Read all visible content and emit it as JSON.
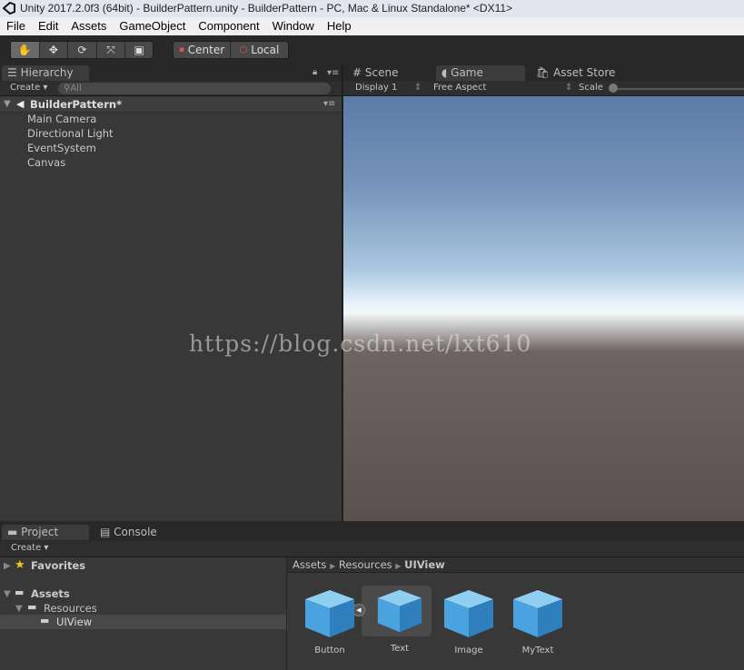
{
  "window": {
    "title": "Unity 2017.2.0f3 (64bit) - BuilderPattern.unity - BuilderPattern - PC, Mac & Linux Standalone* <DX11>"
  },
  "menu": [
    "File",
    "Edit",
    "Assets",
    "GameObject",
    "Component",
    "Window",
    "Help"
  ],
  "toolbar": {
    "tools": [
      "hand-tool",
      "move-tool",
      "rotate-tool",
      "scale-tool",
      "rect-tool"
    ],
    "pivot": "Center",
    "space": "Local"
  },
  "hierarchy": {
    "tab": "Hierarchy",
    "create": "Create",
    "search_placeholder": "All",
    "scene": "BuilderPattern*",
    "items": [
      "Main Camera",
      "Directional Light",
      "EventSystem",
      "Canvas"
    ]
  },
  "game": {
    "tabs": [
      "Scene",
      "Game",
      "Asset Store"
    ],
    "active_tab": "Game",
    "display": "Display 1",
    "aspect": "Free Aspect",
    "scale_label": "Scale",
    "scale_value": 0
  },
  "watermark": "https://blog.csdn.net/lxt610",
  "project": {
    "tabs": [
      "Project",
      "Console"
    ],
    "create": "Create",
    "favorites": "Favorites",
    "tree": {
      "root": "Assets",
      "child": "Resources",
      "selected": "UIView"
    },
    "breadcrumb": [
      "Assets",
      "Resources",
      "UIView"
    ],
    "assets": [
      {
        "name": "Button"
      },
      {
        "name": "Text",
        "selected": true
      },
      {
        "name": "Image"
      },
      {
        "name": "MyText"
      }
    ]
  },
  "colors": {
    "asset_cube": "#4aa3df",
    "selection": "#484848"
  }
}
